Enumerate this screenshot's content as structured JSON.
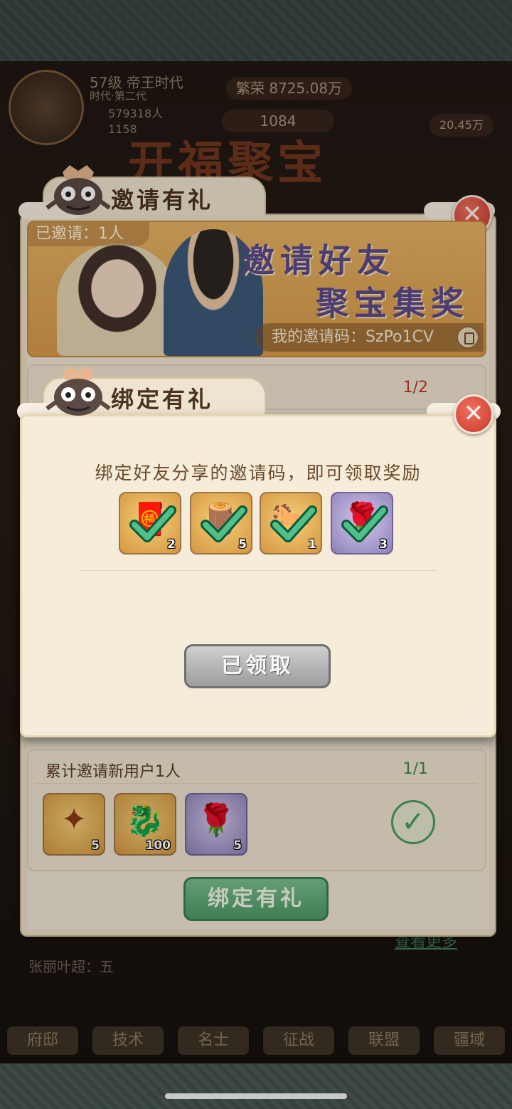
{
  "hud": {
    "level": "57级 帝王时代",
    "sub": "时代·第二代",
    "power": "579318人",
    "gold": "1158",
    "prosperity": "繁荣 8725.08万",
    "coins": "1084",
    "food": "20.45万"
  },
  "background_title": "开福聚宝",
  "nav": [
    "府邸",
    "技术",
    "名士",
    "征战",
    "联盟",
    "疆域"
  ],
  "feed": "张丽叶超：五",
  "view_more": "查看更多",
  "invite_panel": {
    "title": "邀请有礼",
    "invited_count": "已邀请：1人",
    "banner_line1": "邀请好友",
    "banner_line2": "聚宝集奖",
    "invite_code": "我的邀请码：SzPo1CV",
    "section1_progress": "1/2",
    "section2": {
      "title": "累计邀请新用户1人",
      "progress": "1/1",
      "rewards": [
        {
          "icon": "token-icon",
          "glyph": "✦",
          "count": "5"
        },
        {
          "icon": "jade-dragon-icon",
          "glyph": "🐉",
          "count": "100"
        },
        {
          "icon": "rose-icon",
          "glyph": "🌹",
          "count": "5",
          "rarity": "purple"
        }
      ]
    },
    "bind_button": "绑定有礼"
  },
  "bind_popup": {
    "title": "绑定有礼",
    "description": "绑定好友分享的邀请码，即可领取奖励",
    "rewards": [
      {
        "icon": "red-envelope-icon",
        "glyph": "🧧",
        "count": "2"
      },
      {
        "icon": "wood-log-icon",
        "glyph": "🪵",
        "count": "5"
      },
      {
        "icon": "black-horse-icon",
        "glyph": "🐎",
        "count": "1"
      },
      {
        "icon": "rose-icon",
        "glyph": "🌹",
        "count": "3",
        "rarity": "purple"
      }
    ],
    "claimed_button": "已领取"
  },
  "colors": {
    "accent_green": "#4f9a66",
    "close_red": "#c9382a",
    "banner_purple": "#5d4a8a"
  }
}
